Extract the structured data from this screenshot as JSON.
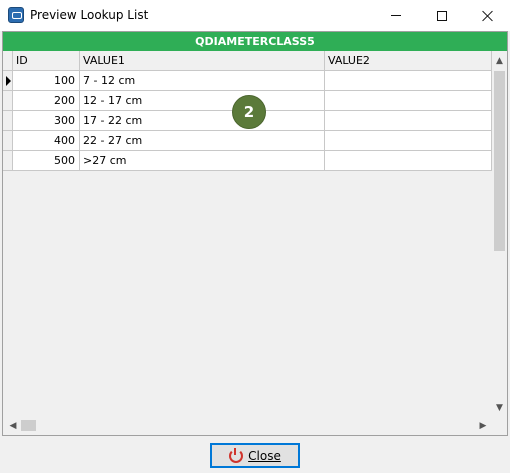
{
  "window": {
    "title": "Preview Lookup List",
    "icon": "app-icon"
  },
  "grid": {
    "caption": "QDIAMETERCLASS5",
    "caption_color": "#2fae56",
    "columns": [
      "ID",
      "VALUE1",
      "VALUE2"
    ],
    "rows": [
      {
        "id": "100",
        "value1": "7 - 12 cm",
        "value2": ""
      },
      {
        "id": "200",
        "value1": "12 - 17 cm",
        "value2": ""
      },
      {
        "id": "300",
        "value1": "17 - 22 cm",
        "value2": ""
      },
      {
        "id": "400",
        "value1": "22 - 27 cm",
        "value2": ""
      },
      {
        "id": "500",
        "value1": ">27 cm",
        "value2": ""
      }
    ]
  },
  "badge": {
    "label": "2",
    "color": "#5b7a3a"
  },
  "footer": {
    "close_label": "Close",
    "close_icon": "power-icon"
  }
}
